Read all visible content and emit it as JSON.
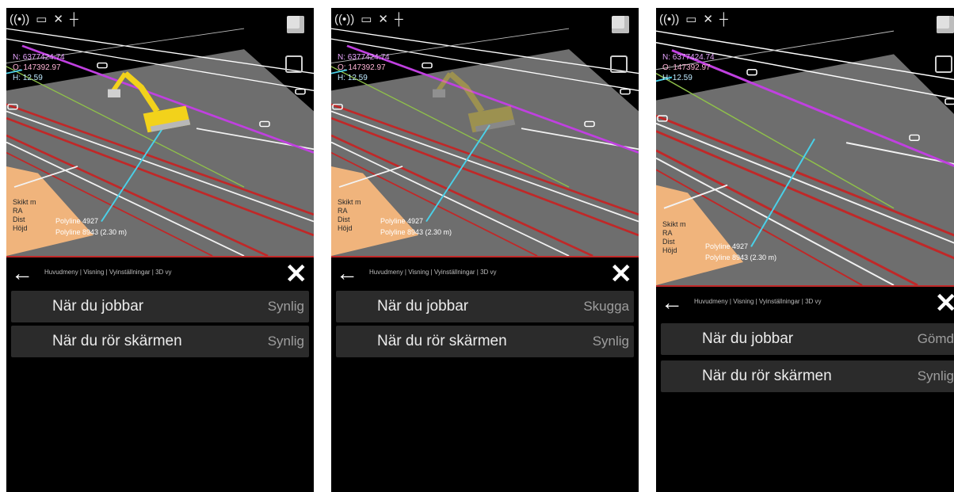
{
  "status_icons": [
    {
      "icon": "antenna-icon",
      "glyph": "((•))"
    },
    {
      "icon": "gnss-receiver-icon",
      "glyph": "▭"
    },
    {
      "icon": "satellite-icon",
      "glyph": "✕"
    },
    {
      "icon": "crosshair-icon",
      "glyph": "┼"
    }
  ],
  "coords": {
    "n": "N: 6377424.74",
    "e": "O: 147392.97",
    "h": "H: 12.59"
  },
  "polylines": {
    "line1": "Polyline 4927",
    "line2": "Polyline 8943 (2.30 m)"
  },
  "map_labels": {
    "a": "Skikt m",
    "b": "RA",
    "c": "Dist",
    "d": "Höjd"
  },
  "breadcrumb": "Huvudmeny | Visning | Vyinställningar | 3D vy",
  "panels": [
    {
      "rows": [
        {
          "label": "När du jobbar",
          "value": "Synlig"
        },
        {
          "label": "När du rör skärmen",
          "value": "Synlig"
        }
      ]
    },
    {
      "rows": [
        {
          "label": "När du jobbar",
          "value": "Skugga"
        },
        {
          "label": "När du rör skärmen",
          "value": "Synlig"
        }
      ]
    },
    {
      "rows": [
        {
          "label": "När du jobbar",
          "value": "Gömd"
        },
        {
          "label": "När du rör skärmen",
          "value": "Synlig"
        }
      ]
    }
  ],
  "machine_visibility": [
    "Synlig",
    "Skugga",
    "Gömd"
  ],
  "colors": {
    "accent_red": "#c02828",
    "road_grey": "#6e6e6e",
    "excavator_yellow": "#f2d21b",
    "fill_orange": "#f0b47c"
  }
}
